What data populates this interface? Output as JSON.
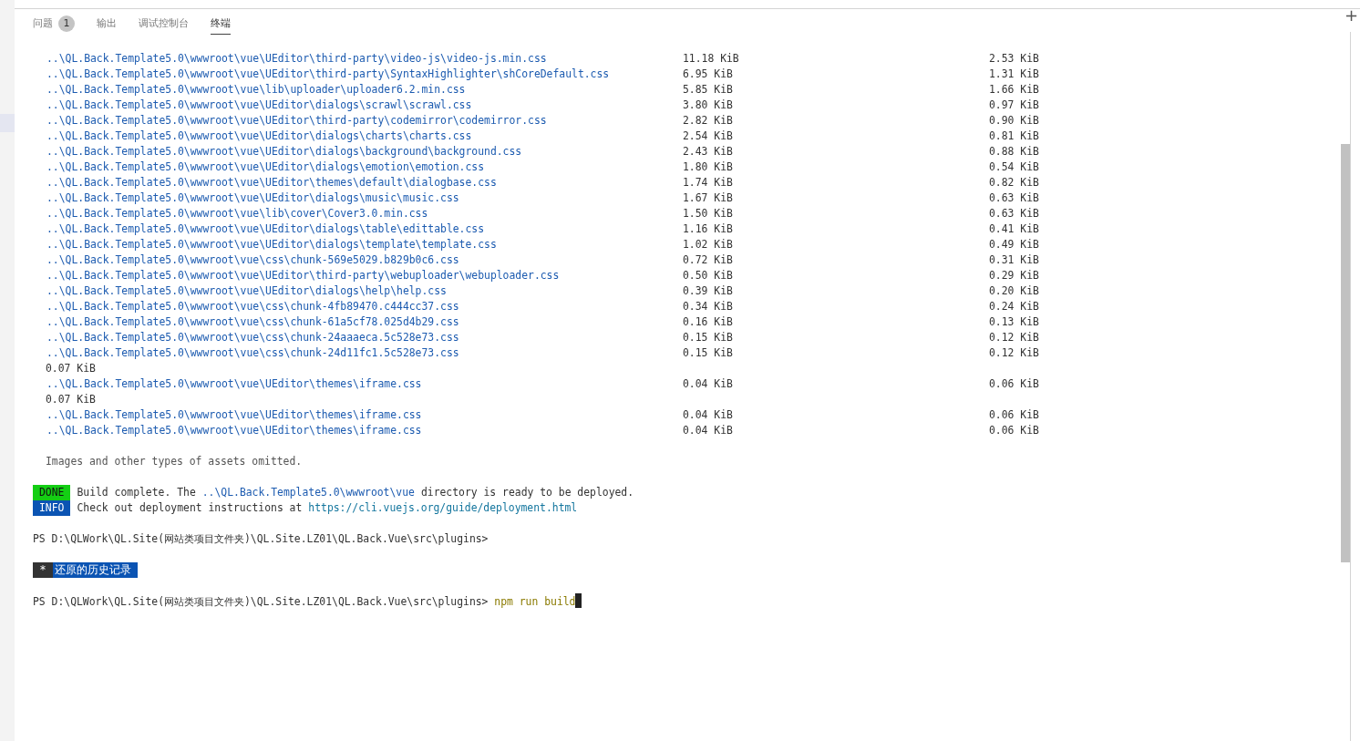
{
  "panel_tabs": [
    {
      "label": "问题",
      "badge": "1",
      "selected": false
    },
    {
      "label": "输出",
      "selected": false
    },
    {
      "label": "调试控制台",
      "selected": false
    },
    {
      "label": "终端",
      "selected": true
    }
  ],
  "new_terminal": "+",
  "terminal": {
    "assets": [
      {
        "kind": "asset",
        "path": "..\\QL.Back.Template5.0\\wwwroot\\vue\\UEditor\\third-party\\video-js\\video-js.min.css",
        "size": "11.18 KiB",
        "gzipped": "2.53 KiB"
      },
      {
        "kind": "asset",
        "path": "..\\QL.Back.Template5.0\\wwwroot\\vue\\UEditor\\third-party\\SyntaxHighlighter\\shCoreDefault.css",
        "size": "6.95 KiB",
        "gzipped": "1.31 KiB"
      },
      {
        "kind": "asset",
        "path": "..\\QL.Back.Template5.0\\wwwroot\\vue\\lib\\uploader\\uploader6.2.min.css",
        "size": "5.85 KiB",
        "gzipped": "1.66 KiB"
      },
      {
        "kind": "asset",
        "path": "..\\QL.Back.Template5.0\\wwwroot\\vue\\UEditor\\dialogs\\scrawl\\scrawl.css",
        "size": "3.80 KiB",
        "gzipped": "0.97 KiB"
      },
      {
        "kind": "asset",
        "path": "..\\QL.Back.Template5.0\\wwwroot\\vue\\UEditor\\third-party\\codemirror\\codemirror.css",
        "size": "2.82 KiB",
        "gzipped": "0.90 KiB"
      },
      {
        "kind": "asset",
        "path": "..\\QL.Back.Template5.0\\wwwroot\\vue\\UEditor\\dialogs\\charts\\charts.css",
        "size": "2.54 KiB",
        "gzipped": "0.81 KiB"
      },
      {
        "kind": "asset",
        "path": "..\\QL.Back.Template5.0\\wwwroot\\vue\\UEditor\\dialogs\\background\\background.css",
        "size": "2.43 KiB",
        "gzipped": "0.88 KiB"
      },
      {
        "kind": "asset",
        "path": "..\\QL.Back.Template5.0\\wwwroot\\vue\\UEditor\\dialogs\\emotion\\emotion.css",
        "size": "1.80 KiB",
        "gzipped": "0.54 KiB"
      },
      {
        "kind": "asset",
        "path": "..\\QL.Back.Template5.0\\wwwroot\\vue\\UEditor\\themes\\default\\dialogbase.css",
        "size": "1.74 KiB",
        "gzipped": "0.82 KiB"
      },
      {
        "kind": "asset",
        "path": "..\\QL.Back.Template5.0\\wwwroot\\vue\\UEditor\\dialogs\\music\\music.css",
        "size": "1.67 KiB",
        "gzipped": "0.63 KiB"
      },
      {
        "kind": "asset",
        "path": "..\\QL.Back.Template5.0\\wwwroot\\vue\\lib\\cover\\Cover3.0.min.css",
        "size": "1.50 KiB",
        "gzipped": "0.63 KiB"
      },
      {
        "kind": "asset",
        "path": "..\\QL.Back.Template5.0\\wwwroot\\vue\\UEditor\\dialogs\\table\\edittable.css",
        "size": "1.16 KiB",
        "gzipped": "0.41 KiB"
      },
      {
        "kind": "asset",
        "path": "..\\QL.Back.Template5.0\\wwwroot\\vue\\UEditor\\dialogs\\template\\template.css",
        "size": "1.02 KiB",
        "gzipped": "0.49 KiB"
      },
      {
        "kind": "asset",
        "path": "..\\QL.Back.Template5.0\\wwwroot\\vue\\css\\chunk-569e5029.b829b0c6.css",
        "size": "0.72 KiB",
        "gzipped": "0.31 KiB"
      },
      {
        "kind": "asset",
        "path": "..\\QL.Back.Template5.0\\wwwroot\\vue\\UEditor\\third-party\\webuploader\\webuploader.css",
        "size": "0.50 KiB",
        "gzipped": "0.29 KiB"
      },
      {
        "kind": "asset",
        "path": "..\\QL.Back.Template5.0\\wwwroot\\vue\\UEditor\\dialogs\\help\\help.css",
        "size": "0.39 KiB",
        "gzipped": "0.20 KiB"
      },
      {
        "kind": "asset",
        "path": "..\\QL.Back.Template5.0\\wwwroot\\vue\\css\\chunk-4fb89470.c444cc37.css",
        "size": "0.34 KiB",
        "gzipped": "0.24 KiB"
      },
      {
        "kind": "asset",
        "path": "..\\QL.Back.Template5.0\\wwwroot\\vue\\css\\chunk-61a5cf78.025d4b29.css",
        "size": "0.16 KiB",
        "gzipped": "0.13 KiB"
      },
      {
        "kind": "asset",
        "path": "..\\QL.Back.Template5.0\\wwwroot\\vue\\css\\chunk-24aaaeca.5c528e73.css",
        "size": "0.15 KiB",
        "gzipped": "0.12 KiB"
      },
      {
        "kind": "asset",
        "path": "..\\QL.Back.Template5.0\\wwwroot\\vue\\css\\chunk-24d11fc1.5c528e73.css",
        "size": "0.15 KiB",
        "gzipped": "0.12 KiB"
      },
      {
        "kind": "size",
        "text": "0.07 KiB"
      },
      {
        "kind": "asset",
        "path": "..\\QL.Back.Template5.0\\wwwroot\\vue\\UEditor\\themes\\iframe.css",
        "size": "0.04 KiB",
        "gzipped": "0.06 KiB"
      },
      {
        "kind": "size",
        "text": "0.07 KiB"
      },
      {
        "kind": "asset",
        "path": "..\\QL.Back.Template5.0\\wwwroot\\vue\\UEditor\\themes\\iframe.css",
        "size": "0.04 KiB",
        "gzipped": "0.06 KiB"
      },
      {
        "kind": "asset",
        "path": "..\\QL.Back.Template5.0\\wwwroot\\vue\\UEditor\\themes\\iframe.css",
        "size": "0.04 KiB",
        "gzipped": "0.06 KiB"
      }
    ],
    "omitted_note": "Images and other types of assets omitted.",
    "messages": [
      {
        "kind": "done",
        "tag": "DONE",
        "text": "Build complete. The",
        "path": "..\\QL.Back.Template5.0\\wwwroot\\vue",
        "text_after": "directory is ready to be deployed."
      },
      {
        "kind": "info",
        "tag": "INFO",
        "text": "Check out deployment instructions at",
        "link": "https://cli.vuejs.org/guide/deployment.html"
      }
    ],
    "prompt": "PS D:\\QLWork\\QL.Site(网站类项目文件夹)\\QL.Site.LZ01\\QL.Back.Vue\\src\\plugins>",
    "restore": {
      "marker": "*",
      "text": "还原的历史记录"
    },
    "input": {
      "prompt": "PS D:\\QLWork\\QL.Site(网站类项目文件夹)\\QL.Site.LZ01\\QL.Back.Vue\\src\\plugins>",
      "command": "npm run build"
    }
  }
}
